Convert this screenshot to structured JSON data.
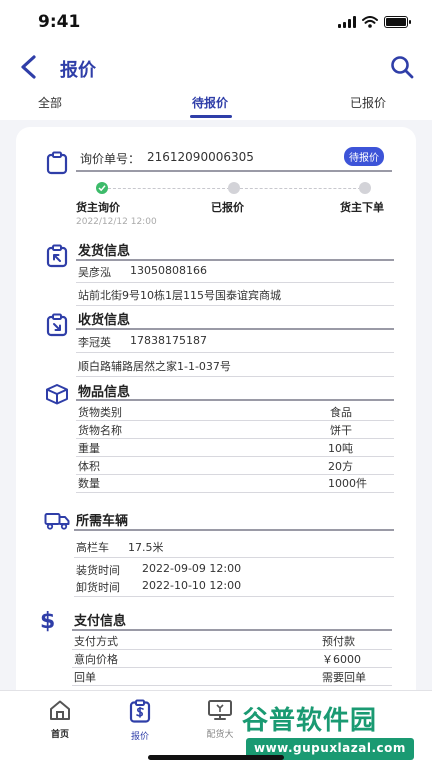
{
  "status_bar": {
    "time": "9:41"
  },
  "nav": {
    "title": "报价"
  },
  "tabs": [
    {
      "label": "全部"
    },
    {
      "label": "待报价"
    },
    {
      "label": "已报价"
    }
  ],
  "order": {
    "number_label": "询价单号：",
    "number": "21612090006305",
    "badge": "待报价",
    "steps": [
      {
        "label": "货主询价",
        "time": "2022/12/12 12:00"
      },
      {
        "label": "已报价"
      },
      {
        "label": "货主下单"
      }
    ]
  },
  "sender": {
    "title": "发货信息",
    "name": "吴彦泓",
    "phone": "13050808166",
    "address": "站前北街9号10栋1层115号国泰谊宾商城"
  },
  "receiver": {
    "title": "收货信息",
    "name": "李冠英",
    "phone": "17838175187",
    "address": "顺白路辅路居然之家1-1-037号"
  },
  "goods": {
    "title": "物品信息",
    "rows": [
      {
        "label": "货物类别",
        "value": "食品"
      },
      {
        "label": "货物名称",
        "value": "饼干"
      },
      {
        "label": "重量",
        "value": "10吨"
      },
      {
        "label": "体积",
        "value": "20方"
      },
      {
        "label": "数量",
        "value": "1000件"
      }
    ]
  },
  "vehicle": {
    "title": "所需车辆",
    "type": "高栏车",
    "length": "17.5米",
    "load_label": "装货时间",
    "load_time": "2022-09-09 12:00",
    "unload_label": "卸货时间",
    "unload_time": "2022-10-10 12:00"
  },
  "payment": {
    "title": "支付信息",
    "rows": [
      {
        "label": "支付方式",
        "value": "预付款"
      },
      {
        "label": "意向价格",
        "value": "￥6000"
      },
      {
        "label": "回单",
        "value": "需要回单"
      }
    ]
  },
  "tabbar": [
    {
      "label": "首页"
    },
    {
      "label": "报价"
    },
    {
      "label": "配货大"
    }
  ],
  "watermark": {
    "top": "谷普软件园",
    "bottom": "www.gupuxlazal.com"
  },
  "colors": {
    "accent": "#2f3ea8",
    "badge": "#3d54d8",
    "step_done": "#3dbb6a",
    "watermark": "#1a9a72"
  }
}
